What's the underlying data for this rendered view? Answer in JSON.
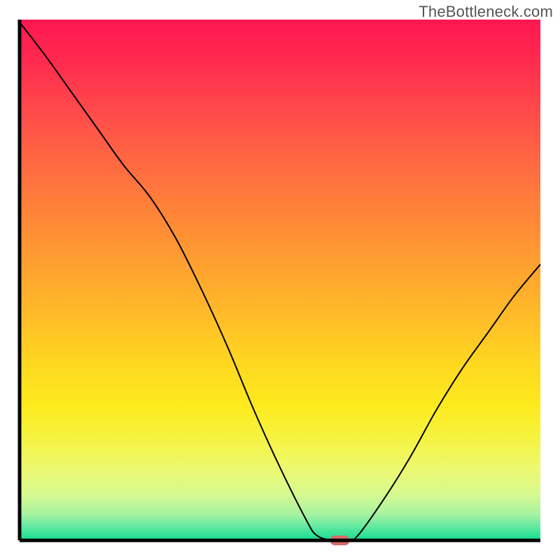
{
  "watermark": "TheBottleneck.com",
  "chart_data": {
    "type": "line",
    "title": "",
    "xlabel": "",
    "ylabel": "",
    "xlim": [
      0,
      100
    ],
    "ylim": [
      0,
      100
    ],
    "x": [
      0,
      5,
      10,
      15,
      20,
      25,
      30,
      35,
      40,
      45,
      50,
      55,
      57,
      60,
      63,
      65,
      70,
      75,
      80,
      85,
      90,
      95,
      100
    ],
    "values": [
      99.5,
      93,
      86,
      79,
      72,
      66,
      58,
      48,
      37,
      25,
      14,
      4,
      1,
      0,
      0,
      1,
      8,
      16,
      25,
      33,
      40,
      47,
      53
    ],
    "series_name": "bottleneck-curve",
    "marker": {
      "x": 61.5,
      "y": 0,
      "color": "#d86a6a"
    },
    "gradient_stops": [
      {
        "offset": 0.0,
        "color": "#ff1750"
      },
      {
        "offset": 0.08,
        "color": "#ff2a4f"
      },
      {
        "offset": 0.18,
        "color": "#ff4c4a"
      },
      {
        "offset": 0.3,
        "color": "#ff703f"
      },
      {
        "offset": 0.42,
        "color": "#ff9234"
      },
      {
        "offset": 0.55,
        "color": "#ffb62a"
      },
      {
        "offset": 0.66,
        "color": "#ffd720"
      },
      {
        "offset": 0.74,
        "color": "#fdea1d"
      },
      {
        "offset": 0.8,
        "color": "#f6f33e"
      },
      {
        "offset": 0.86,
        "color": "#eef86e"
      },
      {
        "offset": 0.91,
        "color": "#d8f98f"
      },
      {
        "offset": 0.95,
        "color": "#a7f3a1"
      },
      {
        "offset": 0.975,
        "color": "#5de8a0"
      },
      {
        "offset": 1.0,
        "color": "#11dd91"
      }
    ],
    "axis_color": "#000000",
    "line_color": "#000000"
  }
}
